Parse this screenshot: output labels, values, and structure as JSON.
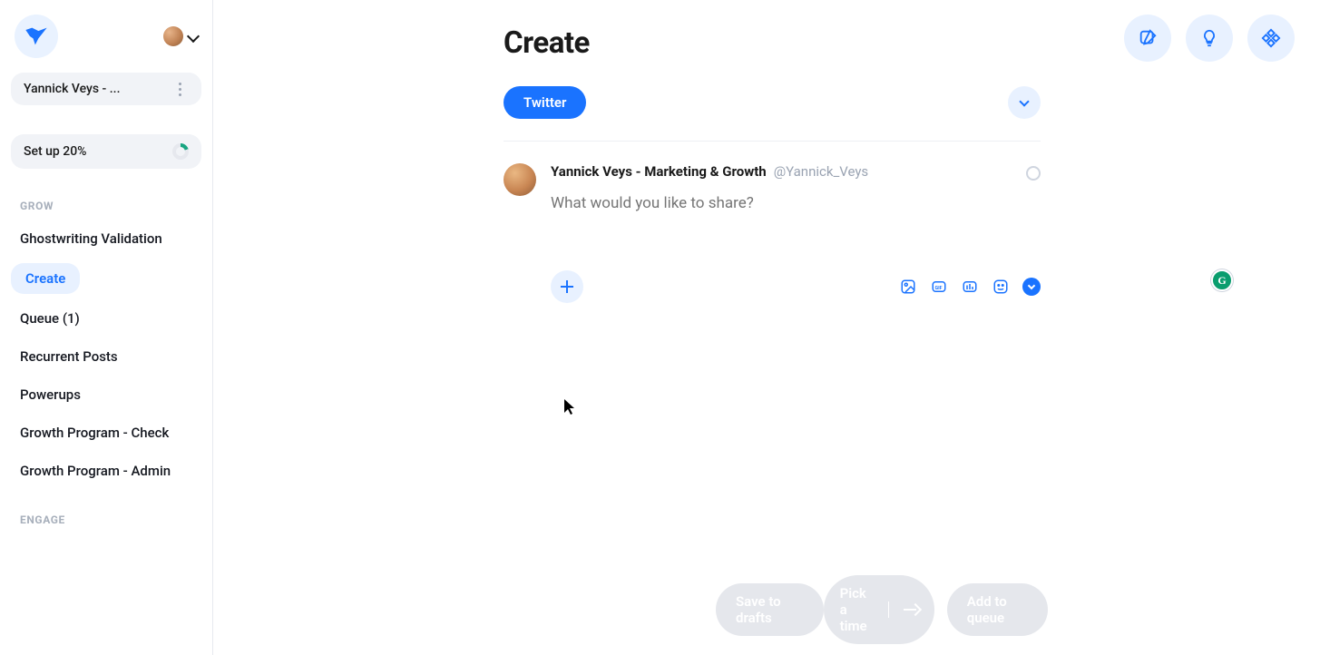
{
  "sidebar": {
    "profile_label": "Yannick Veys - ...",
    "setup_label": "Set up 20%",
    "section_grow": "GROW",
    "section_engage": "ENGAGE",
    "items": [
      {
        "label": "Ghostwriting Validation"
      },
      {
        "label": "Create"
      },
      {
        "label": "Queue (1)"
      },
      {
        "label": "Recurrent Posts"
      },
      {
        "label": "Powerups"
      },
      {
        "label": "Growth Program - Check"
      },
      {
        "label": "Growth Program - Admin"
      }
    ]
  },
  "header": {
    "title": "Create"
  },
  "platform": {
    "selected": "Twitter"
  },
  "composer": {
    "name": "Yannick Veys - Marketing & Growth",
    "handle": "@Yannick_Veys",
    "placeholder": "What would you like to share?"
  },
  "footer": {
    "save_drafts": "Save to drafts",
    "pick_time": "Pick a time",
    "add_queue": "Add to queue"
  },
  "colors": {
    "accent": "#1a73ff",
    "soft_blue": "#e8f1ff",
    "muted": "#9aa3b2",
    "chip_bg": "#f1f3f7"
  }
}
